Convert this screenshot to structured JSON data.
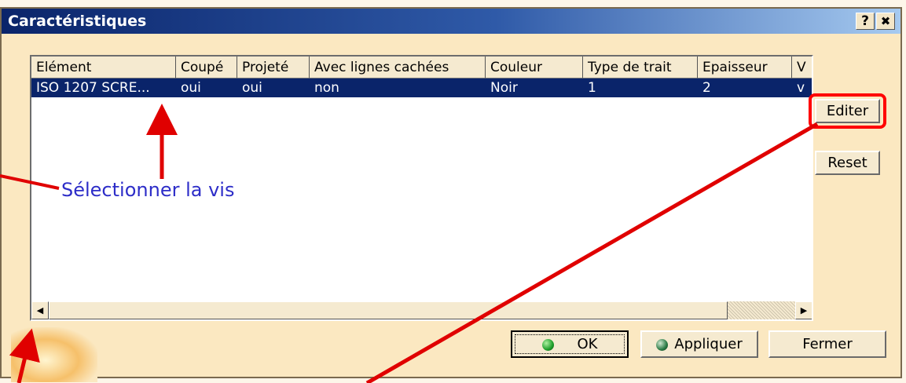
{
  "window": {
    "title": "Caractéristiques",
    "help_glyph": "?",
    "close_glyph": "✖"
  },
  "table": {
    "columns": [
      "Elément",
      "Coupé",
      "Projeté",
      "Avec lignes cachées",
      "Couleur",
      "Type de trait",
      "Epaisseur",
      "V"
    ],
    "rows": [
      [
        "ISO 1207 SCRE...",
        "oui",
        "oui",
        "non",
        "Noir",
        "1",
        "2",
        "v"
      ]
    ]
  },
  "scrollbar": {
    "left_arrow": "◀",
    "right_arrow": "▶"
  },
  "side_buttons": {
    "edit": "Editer",
    "reset": "Reset"
  },
  "bottom_buttons": {
    "ok": "OK",
    "apply": "Appliquer",
    "close": "Fermer"
  },
  "annotation": {
    "text": "Sélectionner la vis"
  },
  "colors": {
    "selection": "#0a246a",
    "highlight": "#ff0000",
    "annotation_text": "#2d2dc8",
    "ok_ball": "#1e9e2a",
    "apply_ball": "#1e9e2a"
  }
}
